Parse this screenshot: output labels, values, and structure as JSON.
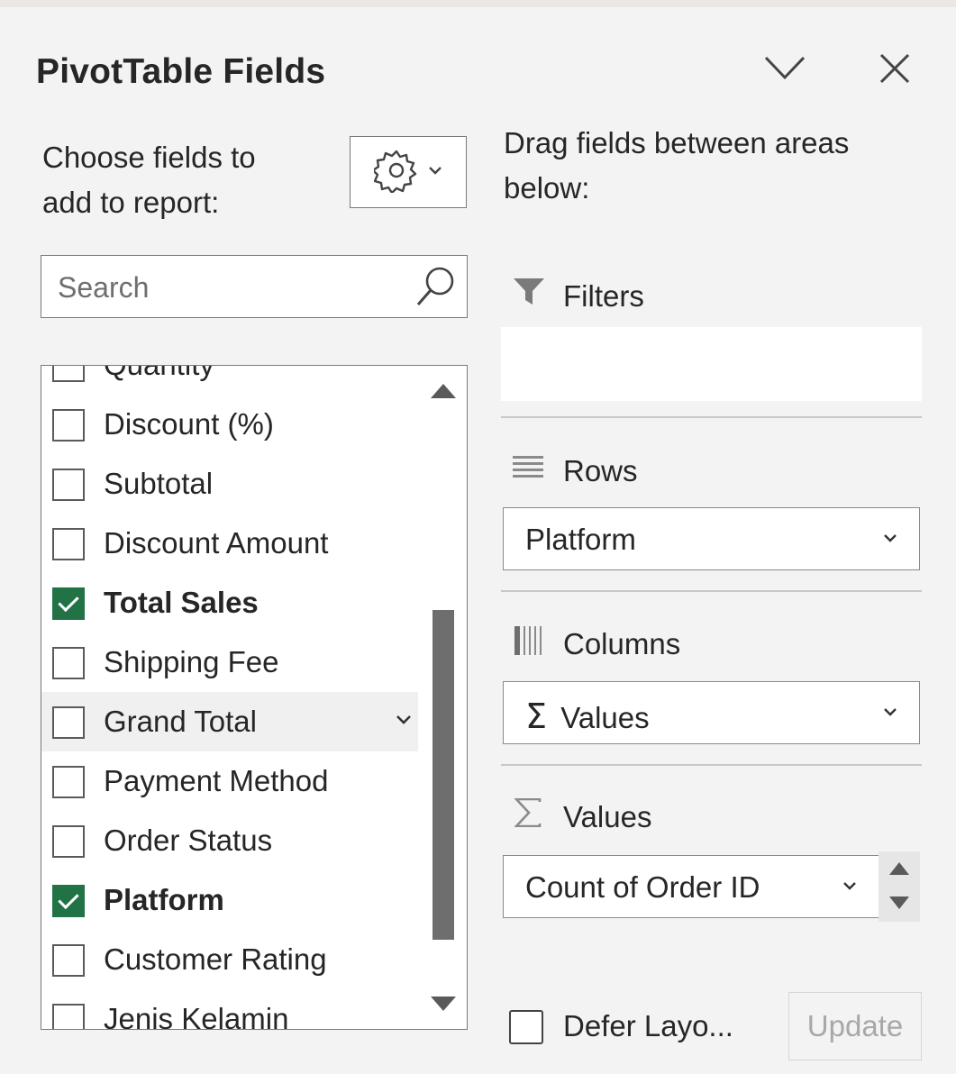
{
  "panel": {
    "title": "PivotTable Fields",
    "choose_text": "Choose fields to add to report:",
    "drag_text": "Drag fields between areas below:"
  },
  "search": {
    "placeholder": "Search"
  },
  "fields": [
    {
      "label": "Quantity",
      "checked": false,
      "bold": false
    },
    {
      "label": "Discount (%)",
      "checked": false,
      "bold": false
    },
    {
      "label": "Subtotal",
      "checked": false,
      "bold": false
    },
    {
      "label": "Discount Amount",
      "checked": false,
      "bold": false
    },
    {
      "label": "Total Sales",
      "checked": true,
      "bold": true
    },
    {
      "label": "Shipping Fee",
      "checked": false,
      "bold": false
    },
    {
      "label": "Grand Total",
      "checked": false,
      "bold": false,
      "hover": true
    },
    {
      "label": "Payment Method",
      "checked": false,
      "bold": false
    },
    {
      "label": "Order Status",
      "checked": false,
      "bold": false
    },
    {
      "label": "Platform",
      "checked": true,
      "bold": true
    },
    {
      "label": "Customer Rating",
      "checked": false,
      "bold": false
    },
    {
      "label": "Jenis Kelamin",
      "checked": false,
      "bold": false
    }
  ],
  "areas": {
    "filters": {
      "label": "Filters"
    },
    "rows": {
      "label": "Rows",
      "item": "Platform"
    },
    "columns": {
      "label": "Columns",
      "item": "Values",
      "item_prefix": "Σ"
    },
    "values": {
      "label": "Values",
      "item": "Count of Order ID"
    }
  },
  "footer": {
    "defer_label": "Defer Layo...",
    "update_label": "Update"
  },
  "colors": {
    "accent": "#217346",
    "panel_bg": "#f3f3f3"
  }
}
